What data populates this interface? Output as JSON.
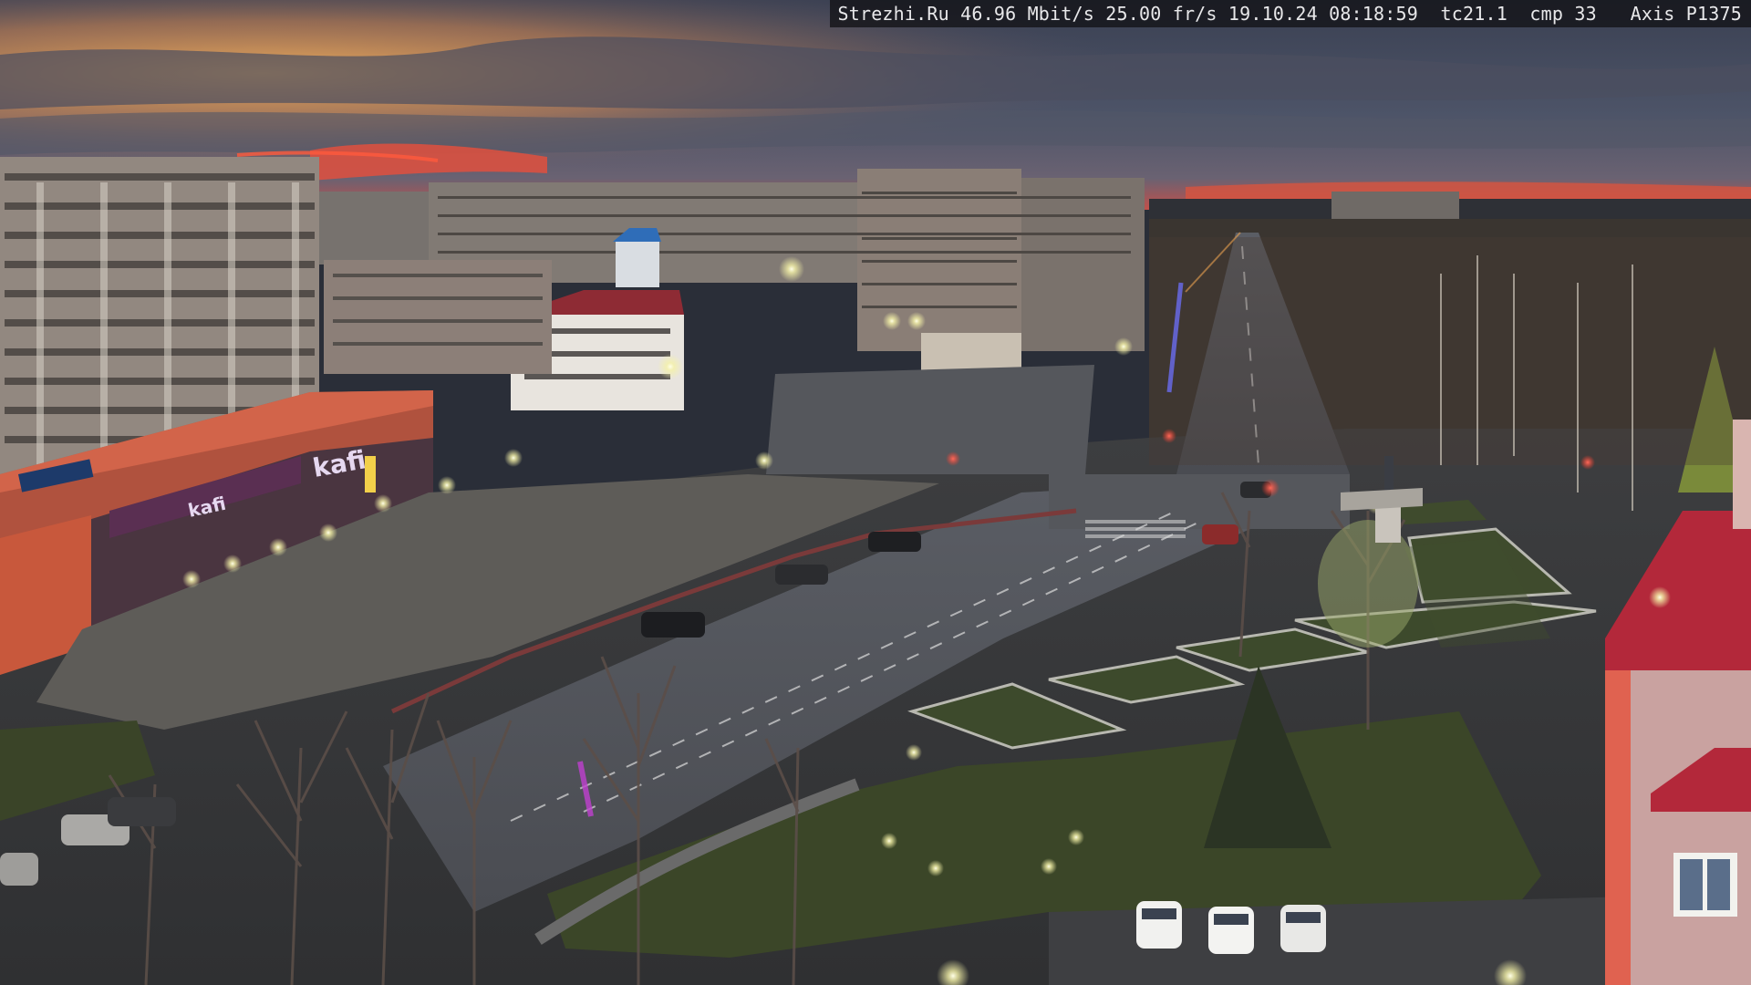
{
  "overlay": {
    "text": "Strezhi.Ru 46.96 Mbit/s 25.00 fr/s 19.10.24 08:18:59  tc21.1  cmp 33   Axis P1375"
  },
  "storefront_signs": [
    "kafi",
    "kafi"
  ],
  "colors": {
    "sky_top": "#3c4253",
    "sunset_glow": "#e8a24a",
    "horizon_red": "#d94a3a",
    "road": "#5b5e66",
    "grass": "#3f4a2c",
    "building_pink": "#c9a2a0",
    "roof_red": "#b3283a"
  }
}
